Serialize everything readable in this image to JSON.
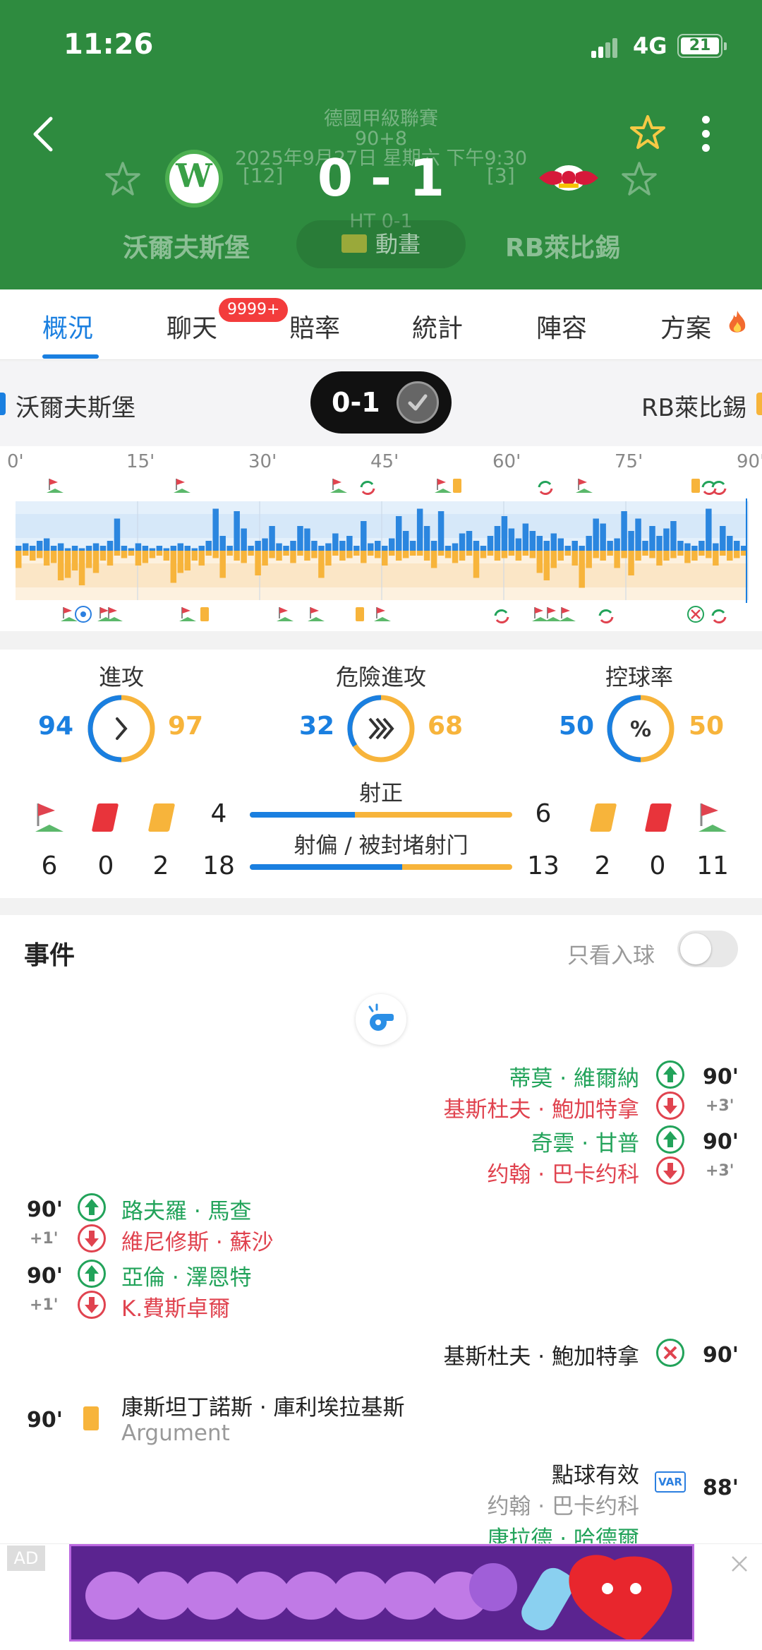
{
  "status_bar": {
    "time": "11:26",
    "network": "4G",
    "battery": "21"
  },
  "match": {
    "league": "德國甲級聯賽",
    "minute": "90+8",
    "datetime": "2025年9月27日 星期六 下午9:30",
    "score": "0 - 1",
    "halftime": "HT 0-1",
    "home": {
      "name": "沃爾夫斯堡",
      "rank": "[12]"
    },
    "away": {
      "name": "RB萊比錫",
      "rank": "[3]"
    },
    "animation_label": "動畫"
  },
  "tabs": [
    {
      "label": "概況",
      "active": true
    },
    {
      "label": "聊天",
      "badge": "9999+"
    },
    {
      "label": "賠率"
    },
    {
      "label": "統計"
    },
    {
      "label": "陣容"
    },
    {
      "label": "方案"
    }
  ],
  "strip": {
    "home": "沃爾夫斯堡",
    "away": "RB萊比錫",
    "score": "0-1"
  },
  "timeline": {
    "ticks": [
      "0'",
      "15'",
      "30'",
      "45'",
      "60'",
      "75'",
      "90'"
    ],
    "home_bars": [
      0.1,
      0.15,
      0.1,
      0.2,
      0.25,
      0.1,
      0.15,
      0.05,
      0.1,
      0.05,
      0.1,
      0.15,
      0.1,
      0.2,
      0.65,
      0.1,
      0.05,
      0.15,
      0.1,
      0.05,
      0.1,
      0.05,
      0.1,
      0.15,
      0.1,
      0.05,
      0.1,
      0.2,
      0.85,
      0.3,
      0.1,
      0.8,
      0.45,
      0.1,
      0.2,
      0.25,
      0.5,
      0.15,
      0.1,
      0.2,
      0.5,
      0.45,
      0.2,
      0.1,
      0.15,
      0.35,
      0.2,
      0.3,
      0.1,
      0.6,
      0.15,
      0.2,
      0.1,
      0.25,
      0.7,
      0.4,
      0.2,
      0.85,
      0.5,
      0.2,
      0.8,
      0.1,
      0.15,
      0.35,
      0.4,
      0.2,
      0.1,
      0.3,
      0.5,
      0.7,
      0.45,
      0.25,
      0.55,
      0.4,
      0.3,
      0.2,
      0.35,
      0.25,
      0.1,
      0.2,
      0.1,
      0.3,
      0.65,
      0.55,
      0.2,
      0.25,
      0.8,
      0.4,
      0.65,
      0.2,
      0.5,
      0.3,
      0.45,
      0.6,
      0.2,
      0.15,
      0.1,
      0.2,
      0.85,
      0.15,
      0.5,
      0.3,
      0.2,
      0.1
    ],
    "away_bars": [
      0.35,
      0.1,
      0.2,
      0.15,
      0.3,
      0.25,
      0.6,
      0.55,
      0.4,
      0.7,
      0.35,
      0.45,
      0.2,
      0.3,
      0.1,
      0.15,
      0.1,
      0.3,
      0.25,
      0.15,
      0.1,
      0.2,
      0.65,
      0.45,
      0.4,
      0.2,
      0.3,
      0.1,
      0.15,
      0.55,
      0.1,
      0.2,
      0.25,
      0.1,
      0.5,
      0.3,
      0.15,
      0.2,
      0.1,
      0.25,
      0.1,
      0.2,
      0.15,
      0.55,
      0.3,
      0.1,
      0.2,
      0.15,
      0.1,
      0.25,
      0.1,
      0.15,
      0.3,
      0.1,
      0.2,
      0.15,
      0.1,
      0.1,
      0.2,
      0.35,
      0.1,
      0.15,
      0.25,
      0.2,
      0.1,
      0.55,
      0.15,
      0.1,
      0.2,
      0.15,
      0.1,
      0.2,
      0.1,
      0.15,
      0.45,
      0.6,
      0.35,
      0.2,
      0.1,
      0.3,
      0.75,
      0.35,
      0.15,
      0.2,
      0.1,
      0.35,
      0.15,
      0.5,
      0.2,
      0.1,
      0.15,
      0.3,
      0.2,
      0.15,
      0.1,
      0.25,
      0.2,
      0.1,
      0.15,
      0.3,
      0.1,
      0.2,
      0.15,
      0.1
    ]
  },
  "stats": {
    "attack": {
      "label": "進攻",
      "home": "94",
      "away": "97"
    },
    "danger": {
      "label": "危險進攻",
      "home": "32",
      "away": "68"
    },
    "possession": {
      "label": "控球率",
      "home": "50",
      "away": "50"
    },
    "shots_on": {
      "label": "射正",
      "home": "4",
      "away": "6",
      "home_share": 0.4
    },
    "shots_off": {
      "label": "射偏 / 被封堵射门",
      "home": "18",
      "away": "13",
      "home_share": 0.58
    },
    "home_corners": "6",
    "home_red": "0",
    "home_yellow": "2",
    "away_yellow": "2",
    "away_red": "0",
    "away_corners": "11"
  },
  "events": {
    "title": "事件",
    "goal_only": "只看入球",
    "items": {
      "a1_in": "蒂莫 · 維爾納",
      "a1_out": "基斯杜夫 · 鮑加特拿",
      "a1_min": "90'",
      "a1_extra": "+3'",
      "a2_in": "奇雲 · 甘普",
      "a2_out": "约翰 · 巴卡约科",
      "a2_min": "90'",
      "a2_extra": "+3'",
      "h1_in": "路夫羅 · 馬查",
      "h1_out": "維尼修斯 · 蘇沙",
      "h1_min": "90'",
      "h1_extra": "+1'",
      "h2_in": "亞倫 · 澤恩特",
      "h2_out": "K.費斯卓爾",
      "h2_min": "90'",
      "h2_extra": "+1'",
      "a3_text": "基斯杜夫 · 鮑加特拿",
      "a3_min": "90'",
      "h3_text": "康斯坦丁諾斯 · 庫利埃拉基斯",
      "h3_sub": "Argument",
      "h3_min": "90'",
      "a4_text": "點球有效",
      "a4_sub": "约翰 · 巴卡约科",
      "a4_min": "88'",
      "a5_text": "康拉德 · 哈德爾"
    }
  },
  "ad": {
    "tag": "AD"
  },
  "colors": {
    "brand_green": "#2e8b3f",
    "home_blue": "#1a7fe0",
    "away_orange": "#f7b43b",
    "in_green": "#22a35a",
    "out_red": "#e0434f"
  }
}
